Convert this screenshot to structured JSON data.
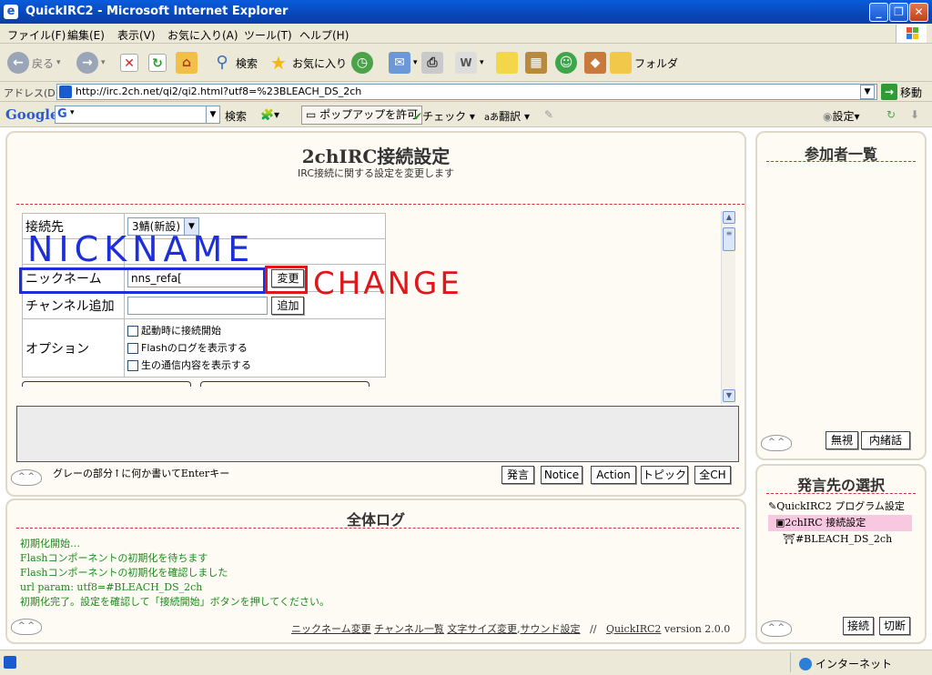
{
  "window": {
    "title": "QuickIRC2 - Microsoft Internet Explorer",
    "app_icon": "ie-icon",
    "controls": [
      "_",
      "❐",
      "✕"
    ]
  },
  "menu": {
    "items": [
      "ファイル(F)",
      "編集(E)",
      "表示(V)",
      "お気に入り(A)",
      "ツール(T)",
      "ヘルプ(H)"
    ]
  },
  "toolbar": {
    "back": "戻る",
    "search": "検索",
    "favorites": "お気に入り",
    "folder": "フォルダ"
  },
  "address": {
    "label": "アドレス(D)",
    "url": "http://irc.2ch.net/qi2/qi2.html?utf8=%23BLEACH_DS_2ch",
    "go": "移動"
  },
  "googlebar": {
    "logo": "Google",
    "g_icon": "G",
    "search": "検索",
    "popup": "ポップアップを許可",
    "check": "チェック",
    "translate": "翻訳",
    "settings": "設定"
  },
  "settings_panel": {
    "title": "2chIRC接続設定",
    "subtitle": "IRC接続に関する設定を変更します",
    "rows": {
      "server_label": "接続先",
      "server_value": "3鯖(新設)",
      "nick_label": "ニックネーム",
      "nick_value": "nns_refa[",
      "nick_button": "変更",
      "channel_label": "チャンネル追加",
      "channel_button": "追加",
      "options_label": "オプション",
      "options": [
        "起動時に接続開始",
        "Flashのログを表示する",
        "生の通信内容を表示する"
      ]
    },
    "hint": "グレーの部分↑に何か書いてEnterキー",
    "action_buttons": [
      "発言",
      "Notice",
      "Action",
      "トピック",
      "全CH"
    ]
  },
  "members_panel": {
    "title": "参加者一覧",
    "buttons": [
      "無視",
      "内緒話"
    ]
  },
  "log_panel": {
    "title": "全体ログ",
    "lines": [
      "初期化開始…",
      "Flashコンポーネントの初期化を待ちます",
      "Flashコンポーネントの初期化を確認しました",
      "url param: utf8=#BLEACH_DS_2ch",
      "初期化完了。設定を確認して「接続開始」ボタンを押してください。"
    ],
    "footer_links": [
      "ニックネーム変更",
      "チャンネル一覧",
      "文字サイズ変更",
      "サウンド設定"
    ],
    "footer_sep": "//",
    "footer_app": "QuickIRC2",
    "footer_version": "version 2.0.0"
  },
  "target_panel": {
    "title": "発言先の選択",
    "items": [
      "QuickIRC2 プログラム設定",
      "2chIRC 接続設定",
      "#BLEACH_DS_2ch"
    ],
    "buttons": [
      "接続",
      "切断"
    ]
  },
  "face_icon": "^ ^",
  "annotations": {
    "nick": "NICKNAME",
    "change": "CHANGE"
  },
  "status": {
    "zone": "インターネット"
  }
}
